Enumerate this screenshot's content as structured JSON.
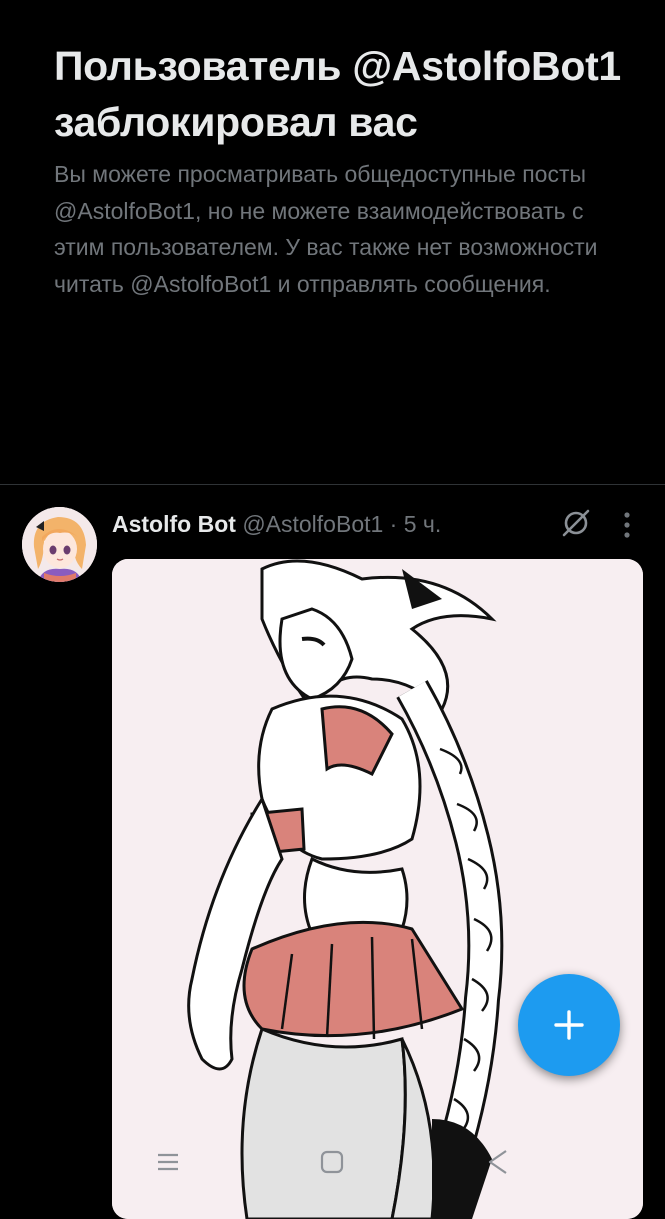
{
  "blocked": {
    "title": "Пользователь @AstolfoBot1 заблокировал вас",
    "description": "Вы можете просматривать общедоступные посты @AstolfoBot1, но не можете взаимодействовать с этим пользователем. У вас также нет возможности читать @AstolfoBot1 и отправлять сообщения."
  },
  "post": {
    "author_name": "Astolfo Bot",
    "meta": "@AstolfoBot1 · 5 ч.",
    "icons": {
      "grok": "grok-slash-icon",
      "more": "more-vertical-icon"
    }
  },
  "fab": {
    "icon": "plus-icon",
    "color": "#1d9bf0"
  },
  "system_nav": {
    "icons": [
      "recents-icon",
      "home-icon",
      "back-icon"
    ]
  },
  "colors": {
    "background": "#000000",
    "text": "#e7e9ea",
    "secondary": "#71767b",
    "accent": "#1d9bf0"
  }
}
